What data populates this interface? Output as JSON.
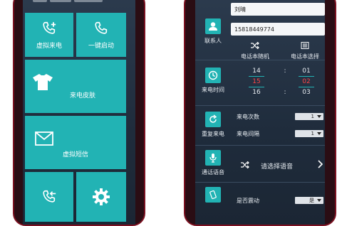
{
  "colors": {
    "tile": "#22b3b4",
    "screen_bg": "#243447",
    "phone_frame": "#7a1020",
    "accent_red": "#ff4545"
  },
  "left_screen": {
    "tiles": [
      {
        "label": "虚拟来电",
        "icon": "phone-plus-icon"
      },
      {
        "label": "一键启动",
        "icon": "phone-icon"
      },
      {
        "label": "来电皮肤",
        "icon": "tshirt-icon"
      },
      {
        "label": "虚拟短信",
        "icon": "envelope-icon"
      },
      {
        "label": "",
        "icon": "call-transfer-icon"
      },
      {
        "label": "",
        "icon": "gear-icon"
      }
    ]
  },
  "right_screen": {
    "contact": {
      "name_value": "刘晴",
      "phone_value": "15818449774",
      "side_label": "联系人",
      "random_label": "电话本随机",
      "select_label": "电话本选择"
    },
    "call_time": {
      "side_label": "来电时间",
      "hours": [
        "14",
        "15",
        "16"
      ],
      "minutes": [
        "01",
        "02",
        "03"
      ],
      "separator": ":"
    },
    "repeat": {
      "side_label": "重复来电",
      "count_label": "来电次数",
      "count_value": "1",
      "interval_label": "来电间隔",
      "interval_value": "1"
    },
    "voice": {
      "side_label": "通话语音",
      "select_label": "请选择语音"
    },
    "vibrate": {
      "label": "是否震动",
      "value": "是"
    }
  }
}
